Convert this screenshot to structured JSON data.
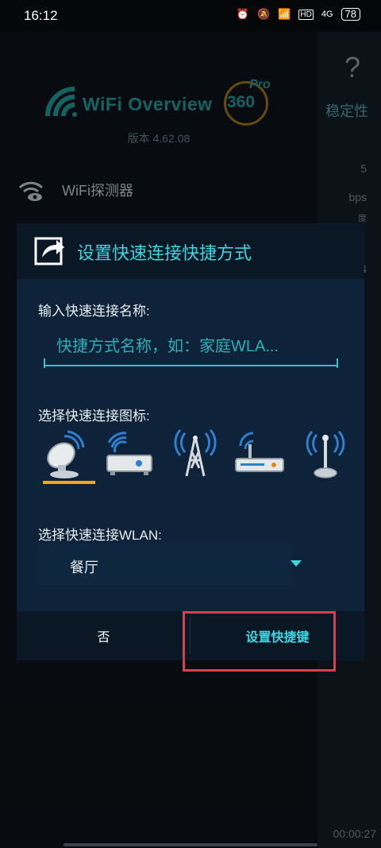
{
  "status_bar": {
    "time": "16:12",
    "hd": "HD",
    "signal": "4G",
    "battery": "78"
  },
  "background": {
    "help": "?",
    "tab_stability": "稳定性",
    "frag_5": "5",
    "frag_bps": "bps",
    "frag_degree": "度",
    "frag_4": "4",
    "timer": "00:00:27"
  },
  "drawer": {
    "logo_text": "WiFi Overview",
    "logo_360": "360",
    "logo_pro": "Pro",
    "version": "版本 4.62.08",
    "menu_items": [
      {
        "label": "WiFi探测器",
        "icon": "wifi-eye-icon"
      }
    ]
  },
  "dialog": {
    "title": "设置快速连接快捷方式",
    "name_label": "输入快速连接名称:",
    "name_placeholder": "快捷方式名称，如：家庭WLA...",
    "icon_label": "选择快速连接图标:",
    "icons": [
      "satellite-dish-icon",
      "router-icon",
      "cell-tower-icon",
      "modem-icon",
      "antenna-icon"
    ],
    "selected_icon_index": 0,
    "wlan_label": "选择快速连接WLAN:",
    "wlan_value": "餐厅",
    "btn_no": "否",
    "btn_ok": "设置快捷键"
  },
  "colors": {
    "accent": "#3cd6e0",
    "selected": "#f6a51b",
    "highlight": "#d6404f"
  }
}
